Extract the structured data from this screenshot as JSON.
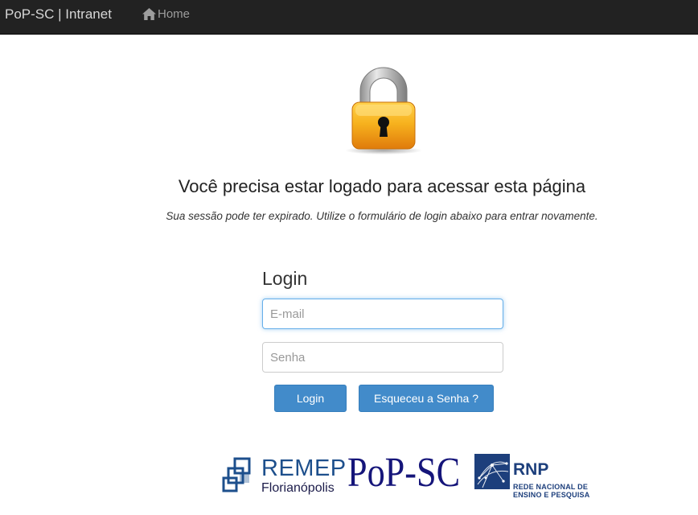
{
  "navbar": {
    "brand": "PoP-SC | Intranet",
    "home_label": "Home",
    "home_icon": "home-icon"
  },
  "main": {
    "lock_icon": "padlock-icon",
    "headline": "Você precisa estar logado para acessar esta página",
    "subline": "Sua sessão pode ter expirado. Utilize o formulário de login abaixo para entrar novamente."
  },
  "login": {
    "title": "Login",
    "email_placeholder": "E-mail",
    "email_value": "",
    "password_placeholder": "Senha",
    "password_value": "",
    "login_button": "Login",
    "forgot_button": "Esqueceu a Senha ?"
  },
  "footer_logos": {
    "remep": "REMEP",
    "remep_city": "Florianópolis",
    "popsc": "PoP-SC",
    "rnp": "RNP",
    "rnp_line1": "REDE NACIONAL DE",
    "rnp_line2": "ENSINO E PESQUISA"
  },
  "colors": {
    "navbar_bg": "#222222",
    "primary_button": "#428bca",
    "focus_border": "#66afe9",
    "lock_body": "#f3a51e"
  }
}
